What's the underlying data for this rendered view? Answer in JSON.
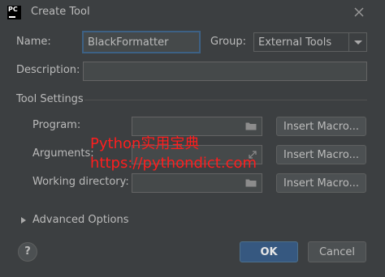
{
  "window": {
    "title": "Create Tool",
    "app_icon_text": "PC"
  },
  "form": {
    "name_label": "Name:",
    "name_value": "BlackFormatter",
    "group_label": "Group:",
    "group_value": "External Tools",
    "description_label": "Description:",
    "description_value": ""
  },
  "tool_settings": {
    "section_title": "Tool Settings",
    "program_label": "Program:",
    "program_value": "",
    "arguments_label": "Arguments:",
    "arguments_value": "",
    "working_dir_label": "Working directory:",
    "working_dir_value": "",
    "insert_macro_label": "Insert Macro..."
  },
  "advanced": {
    "label": "Advanced Options"
  },
  "buttons": {
    "help": "?",
    "ok": "OK",
    "cancel": "Cancel"
  },
  "watermark": {
    "line1": "Python实用宝典",
    "line2": "https://pythondict.com",
    "color": "#ff1e1e"
  },
  "colors": {
    "background": "#3c3f41",
    "field_background": "#45494a",
    "focus_border": "#3d6185",
    "primary_button": "#365880"
  },
  "icons": {
    "close": "close-icon",
    "browse": "folder-icon",
    "expand": "expand-icon",
    "disclosure": "triangle-right-icon",
    "dropdown": "chevron-down-icon"
  }
}
